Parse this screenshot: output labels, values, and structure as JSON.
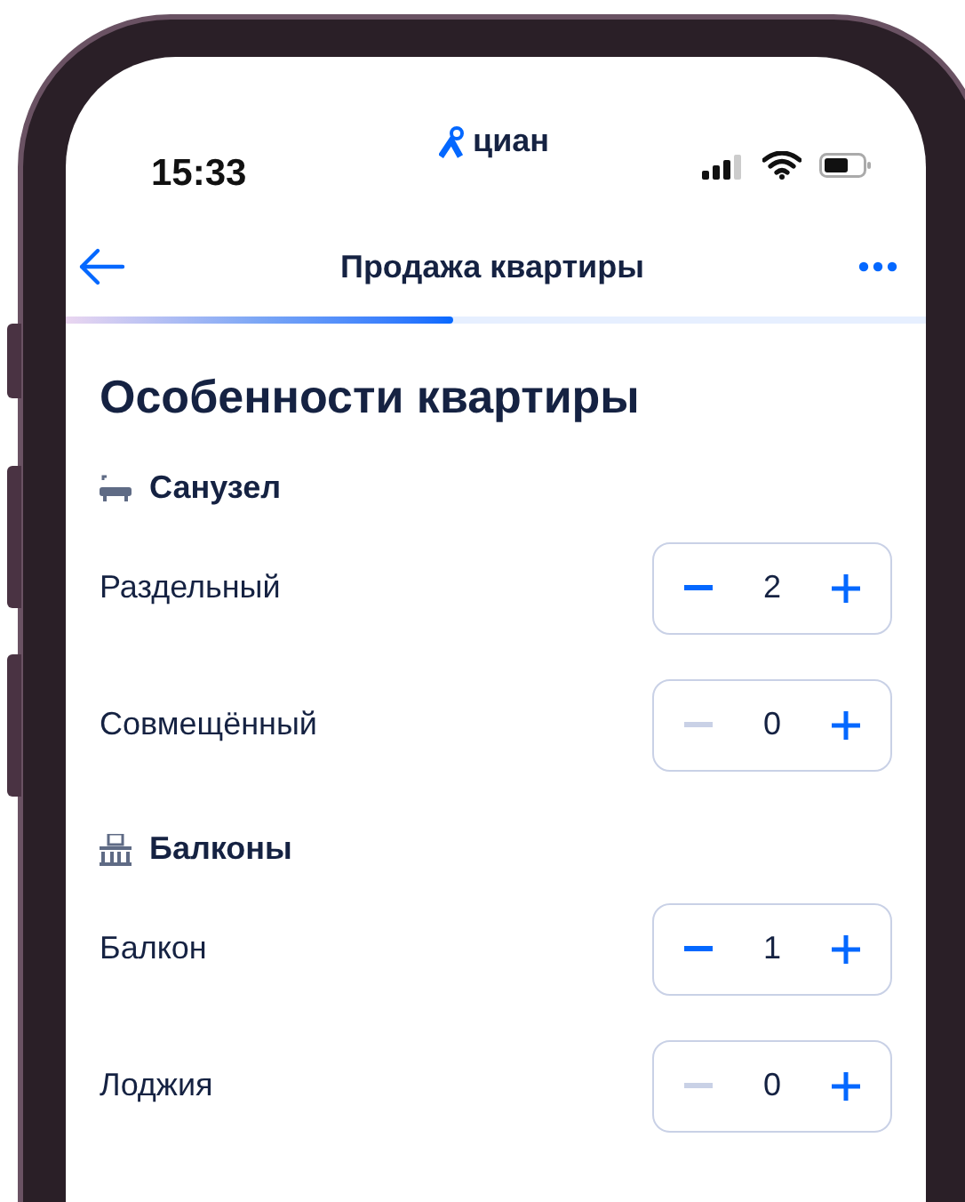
{
  "status_bar": {
    "time": "15:33",
    "logo": "циан"
  },
  "nav": {
    "title": "Продажа квартиры"
  },
  "progress": {
    "level": 0.45
  },
  "page_title": "Особенности квартиры",
  "sections": [
    {
      "kind": "bathroom",
      "title": "Санузел",
      "rows": [
        {
          "label": "Раздельный",
          "value": "2",
          "decrement_disabled": false
        },
        {
          "label": "Совмещённый",
          "value": "0",
          "decrement_disabled": true
        }
      ]
    },
    {
      "kind": "balcony",
      "title": "Балконы",
      "rows": [
        {
          "label": "Балкон",
          "value": "1",
          "decrement_disabled": false
        },
        {
          "label": "Лоджия",
          "value": "0",
          "decrement_disabled": true
        }
      ]
    }
  ]
}
